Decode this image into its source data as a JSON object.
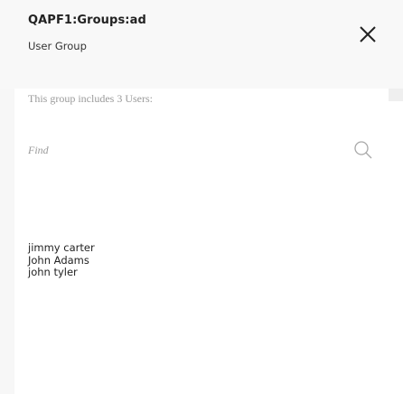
{
  "dialog": {
    "title": "QAPF1:Groups:ad",
    "subtitle": "User Group"
  },
  "content": {
    "info": "This group includes 3 Users:",
    "search": {
      "placeholder": "Find",
      "value": ""
    },
    "users": [
      "jimmy carter",
      "John Adams",
      "john tyler"
    ]
  },
  "icons": {
    "close": "close-icon",
    "search": "search-icon"
  }
}
